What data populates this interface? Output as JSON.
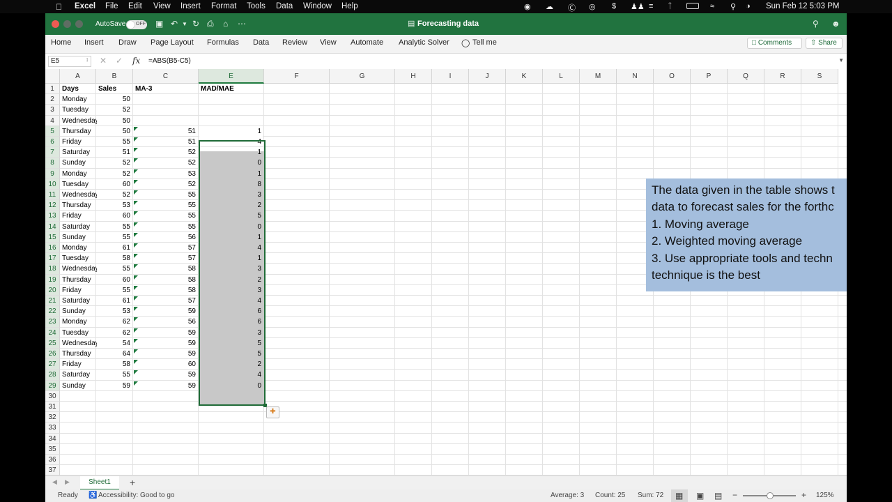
{
  "mac_menubar": {
    "apple_icon": "apple-icon",
    "items": [
      "Excel",
      "File",
      "Edit",
      "View",
      "Insert",
      "Format",
      "Tools",
      "Data",
      "Window",
      "Help"
    ],
    "clock": "Sun Feb 12  5:03 PM"
  },
  "titlebar": {
    "autosave_label": "AutoSave",
    "toggle_state": "OFF",
    "title": "Forecasting data",
    "accent": "#21733f"
  },
  "ribbon": {
    "tabs": [
      "Home",
      "Insert",
      "Draw",
      "Page Layout",
      "Formulas",
      "Data",
      "Review",
      "View",
      "Automate",
      "Analytic Solver"
    ],
    "tell_me": "Tell me",
    "comments": "Comments",
    "share": "Share"
  },
  "formula_bar": {
    "name_box": "E5",
    "fx": "fx",
    "formula": "=ABS(B5-C5)"
  },
  "columns": [
    "A",
    "B",
    "C",
    "E",
    "F",
    "G",
    "H",
    "I",
    "J",
    "K",
    "L",
    "M",
    "N",
    "O",
    "P",
    "Q",
    "R",
    "S"
  ],
  "row_numbers": [
    "1",
    "2",
    "3",
    "4",
    "5",
    "6",
    "7",
    "8",
    "9",
    "10",
    "11",
    "12",
    "13",
    "14",
    "15",
    "16",
    "17",
    "18",
    "19",
    "20",
    "21",
    "22",
    "23",
    "24",
    "25",
    "26",
    "27",
    "28",
    "29",
    "30",
    "31",
    "32",
    "33",
    "34",
    "35",
    "36",
    "37"
  ],
  "headers": {
    "days": "Days",
    "sales": "Sales",
    "ma3": "MA-3",
    "mad": "MAD/MAE"
  },
  "rows": [
    {
      "day": "Monday",
      "sales": "50",
      "ma3": "",
      "mad": ""
    },
    {
      "day": "Tuesday",
      "sales": "52",
      "ma3": "",
      "mad": ""
    },
    {
      "day": "Wednesday",
      "sales": "50",
      "ma3": "",
      "mad": ""
    },
    {
      "day": "Thursday",
      "sales": "50",
      "ma3": "51",
      "mad": "1"
    },
    {
      "day": "Friday",
      "sales": "55",
      "ma3": "51",
      "mad": "4"
    },
    {
      "day": "Saturday",
      "sales": "51",
      "ma3": "52",
      "mad": "1"
    },
    {
      "day": "Sunday",
      "sales": "52",
      "ma3": "52",
      "mad": "0"
    },
    {
      "day": "Monday",
      "sales": "52",
      "ma3": "53",
      "mad": "1"
    },
    {
      "day": "Tuesday",
      "sales": "60",
      "ma3": "52",
      "mad": "8"
    },
    {
      "day": "Wednesday",
      "sales": "52",
      "ma3": "55",
      "mad": "3"
    },
    {
      "day": "Thursday",
      "sales": "53",
      "ma3": "55",
      "mad": "2"
    },
    {
      "day": "Friday",
      "sales": "60",
      "ma3": "55",
      "mad": "5"
    },
    {
      "day": "Saturday",
      "sales": "55",
      "ma3": "55",
      "mad": "0"
    },
    {
      "day": "Sunday",
      "sales": "55",
      "ma3": "56",
      "mad": "1"
    },
    {
      "day": "Monday",
      "sales": "61",
      "ma3": "57",
      "mad": "4"
    },
    {
      "day": "Tuesday",
      "sales": "58",
      "ma3": "57",
      "mad": "1"
    },
    {
      "day": "Wednesday",
      "sales": "55",
      "ma3": "58",
      "mad": "3"
    },
    {
      "day": "Thursday",
      "sales": "60",
      "ma3": "58",
      "mad": "2"
    },
    {
      "day": "Friday",
      "sales": "55",
      "ma3": "58",
      "mad": "3"
    },
    {
      "day": "Saturday",
      "sales": "61",
      "ma3": "57",
      "mad": "4"
    },
    {
      "day": "Sunday",
      "sales": "53",
      "ma3": "59",
      "mad": "6"
    },
    {
      "day": "Monday",
      "sales": "62",
      "ma3": "56",
      "mad": "6"
    },
    {
      "day": "Tuesday",
      "sales": "62",
      "ma3": "59",
      "mad": "3"
    },
    {
      "day": "Wednesday",
      "sales": "54",
      "ma3": "59",
      "mad": "5"
    },
    {
      "day": "Thursday",
      "sales": "64",
      "ma3": "59",
      "mad": "5"
    },
    {
      "day": "Friday",
      "sales": "58",
      "ma3": "60",
      "mad": "2"
    },
    {
      "day": "Saturday",
      "sales": "55",
      "ma3": "59",
      "mad": "4"
    },
    {
      "day": "Sunday",
      "sales": "59",
      "ma3": "59",
      "mad": "0"
    }
  ],
  "textbox_lines": [
    "The data given in the table shows t",
    "data to forecast sales for the forthc",
    "1. Moving average",
    "2. Weighted moving average",
    "3. Use appropriate tools and techn",
    "technique is the best"
  ],
  "textbox_color": "#a4bedd",
  "sheet_tabs": [
    "Sheet1"
  ],
  "add_sheet": "+",
  "status": {
    "ready": "Ready",
    "accessibility": "Accessibility: Good to go",
    "average": "Average: 3",
    "count": "Count: 25",
    "sum": "Sum: 72",
    "zoom": "125%"
  }
}
